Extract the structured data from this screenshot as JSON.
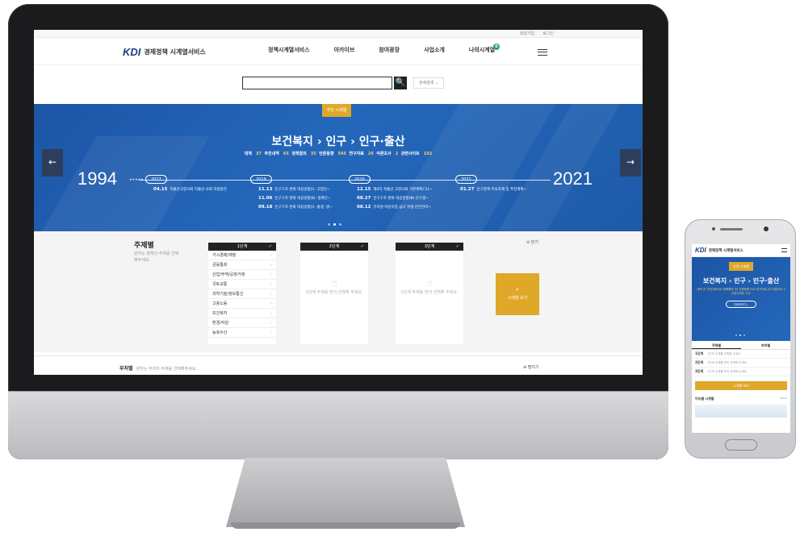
{
  "desktop": {
    "util_links": [
      "회원가입",
      "로그인"
    ],
    "logo": {
      "brand": "KDI",
      "service": "경제정책 시계열서비스"
    },
    "nav": [
      "정책시계열서비스",
      "아카이브",
      "참여광장",
      "사업소개",
      "나의시계열"
    ],
    "nav_badge": "0",
    "search": {
      "value": "",
      "button_icon": "🔍",
      "detail_label": "상세검색 ⌄"
    },
    "banner": {
      "tag": "추천 시계열",
      "title": "보건복지 › 인구 › 인구·출산",
      "stats": [
        {
          "label": "대책",
          "value": "37"
        },
        {
          "label": "추진내역",
          "value": "65"
        },
        {
          "label": "정책협의",
          "value": "35"
        },
        {
          "label": "언론동향",
          "value": "545"
        },
        {
          "label": "연구자료",
          "value": "26"
        },
        {
          "label": "여론조사",
          "value": "2"
        },
        {
          "label": "관련사이트",
          "value": "102"
        }
      ],
      "start_year": "1994",
      "end_year": "2021",
      "timeline_dots": "•••••",
      "year_pills": [
        "2017",
        "2019",
        "2020",
        "2021"
      ],
      "events": [
        {
          "date": "04.15",
          "text": "저출산고령사회 저출산 사회 지원방안"
        },
        {
          "date": "11.13",
          "text": "인구구조 변화 대응방향(Ⅰ): 고령인~"
        },
        {
          "date": "11.06",
          "text": "인구구조 변화 대응방향(Ⅱ): 절벽인~"
        },
        {
          "date": "09.18",
          "text": "인구구조 변화 대응방향(Ⅰ): 출생, 생~"
        },
        {
          "date": "12.15",
          "text": "제4차 저출산 고령사회 기본계획('21~"
        },
        {
          "date": "08.27",
          "text": "인구구조 변화 대응방향(Ⅲ)·인구생~"
        },
        {
          "date": "08.12",
          "text": "유치원·어린이집 급식 위생·안전관리~"
        },
        {
          "date": "01.27",
          "text": "인구정책 주요과제 및 추진계획~"
        }
      ],
      "prev_arrow": "←",
      "next_arrow": "→"
    },
    "subject": {
      "title": "주제별",
      "desc": "원하는 정책의 주제를 선택해주세요.",
      "step1_label": "1단계",
      "step2_label": "2단계",
      "step3_label": "3단계",
      "check": "✓",
      "step1_items": [
        "거시경제/재정",
        "금융통화",
        "산업/무역/공정거래",
        "국토교통",
        "과학기술/정보통신",
        "고용노동",
        "보건복지",
        "환경/자원",
        "농축수산"
      ],
      "step2_empty": "1단계 주제를 먼저 선택해 주세요.",
      "step3_empty": "2단계 주제를 먼저 선택해 주세요.",
      "view_button": "시계열 보기",
      "view_icon": "⌕",
      "close_label": "닫기"
    },
    "bottom": {
      "label": "부처별",
      "desc": "원하는 부처의 주제를 선택해주세요.",
      "open_label": "펼치기"
    }
  },
  "mobile": {
    "logo": {
      "brand": "KDI",
      "service": "경제정책 시계열서비스"
    },
    "tag": "추천 시계열",
    "title": "보건복지 › 인구 › 인구·출산",
    "stats": "대책 37  추진내역 65  정책협의 35  언론동향 545  연구자료 26  여론조사 2  관련사이트 102",
    "more_button": "자세히보기 ›",
    "tabs": [
      "주제별",
      "부처별"
    ],
    "steps": [
      {
        "label": "1단계",
        "text": "1단계 주제를 선택해 주세요."
      },
      {
        "label": "2단계",
        "text": "1단계 주제를 먼저 선택해 주세요."
      },
      {
        "label": "3단계",
        "text": "2단계 주제를 먼저 선택해 주세요."
      }
    ],
    "view_button": "시계열 보기",
    "issue_title": "이슈별 시계열",
    "issue_more": "more"
  },
  "colors": {
    "banner_blue": "#1f5cad",
    "accent_gold": "#e0a829",
    "brand_navy": "#1f3f7a"
  }
}
